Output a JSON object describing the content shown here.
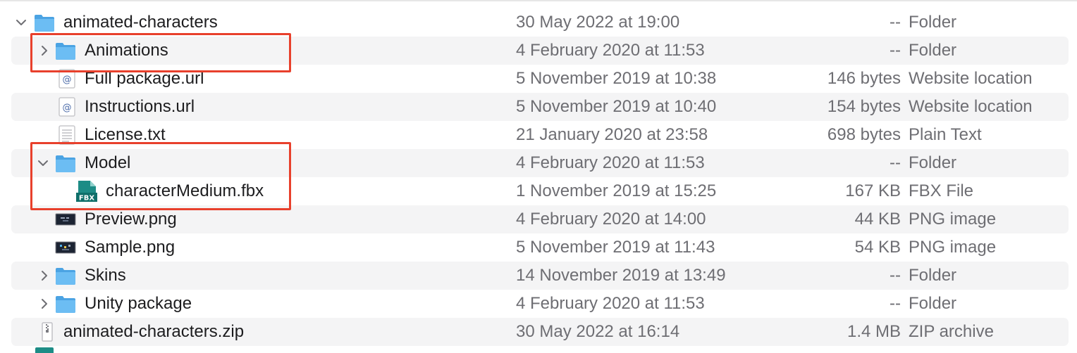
{
  "colors": {
    "row_stripe": "#f4f4f5",
    "folder_blue": "#5ab0ee",
    "highlight_red": "#e8402c",
    "secondary_text": "#6e6e73"
  },
  "rows": [
    {
      "name": "animated-characters",
      "date": "30 May 2022 at 19:00",
      "size": "--",
      "kind": "Folder",
      "icon": "folder-icon",
      "disclosure": "expanded"
    },
    {
      "name": "Animations",
      "date": "4 February 2020 at 11:53",
      "size": "--",
      "kind": "Folder",
      "icon": "folder-icon",
      "disclosure": "collapsed"
    },
    {
      "name": "Full package.url",
      "date": "5 November 2019 at 10:38",
      "size": "146 bytes",
      "kind": "Website location",
      "icon": "url-file-icon"
    },
    {
      "name": "Instructions.url",
      "date": "5 November 2019 at 10:40",
      "size": "154 bytes",
      "kind": "Website location",
      "icon": "url-file-icon"
    },
    {
      "name": "License.txt",
      "date": "21 January 2020 at 23:58",
      "size": "698 bytes",
      "kind": "Plain Text",
      "icon": "text-file-icon"
    },
    {
      "name": "Model",
      "date": "4 February 2020 at 11:53",
      "size": "--",
      "kind": "Folder",
      "icon": "folder-icon",
      "disclosure": "expanded"
    },
    {
      "name": "characterMedium.fbx",
      "date": "1 November 2019 at 15:25",
      "size": "167 KB",
      "kind": "FBX File",
      "icon": "fbx-file-icon",
      "icon_label": "FBX"
    },
    {
      "name": "Preview.png",
      "date": "4 February 2020 at 14:00",
      "size": "44 KB",
      "kind": "PNG image",
      "icon": "image-file-icon"
    },
    {
      "name": "Sample.png",
      "date": "5 November 2019 at 11:43",
      "size": "54 KB",
      "kind": "PNG image",
      "icon": "image-file-icon"
    },
    {
      "name": "Skins",
      "date": "14 November 2019 at 13:49",
      "size": "--",
      "kind": "Folder",
      "icon": "folder-icon",
      "disclosure": "collapsed"
    },
    {
      "name": "Unity package",
      "date": "4 February 2020 at 11:53",
      "size": "--",
      "kind": "Folder",
      "icon": "folder-icon",
      "disclosure": "collapsed"
    },
    {
      "name": "animated-characters.zip",
      "date": "30 May 2022 at 16:14",
      "size": "1.4 MB",
      "kind": "ZIP archive",
      "icon": "zip-file-icon"
    }
  ]
}
